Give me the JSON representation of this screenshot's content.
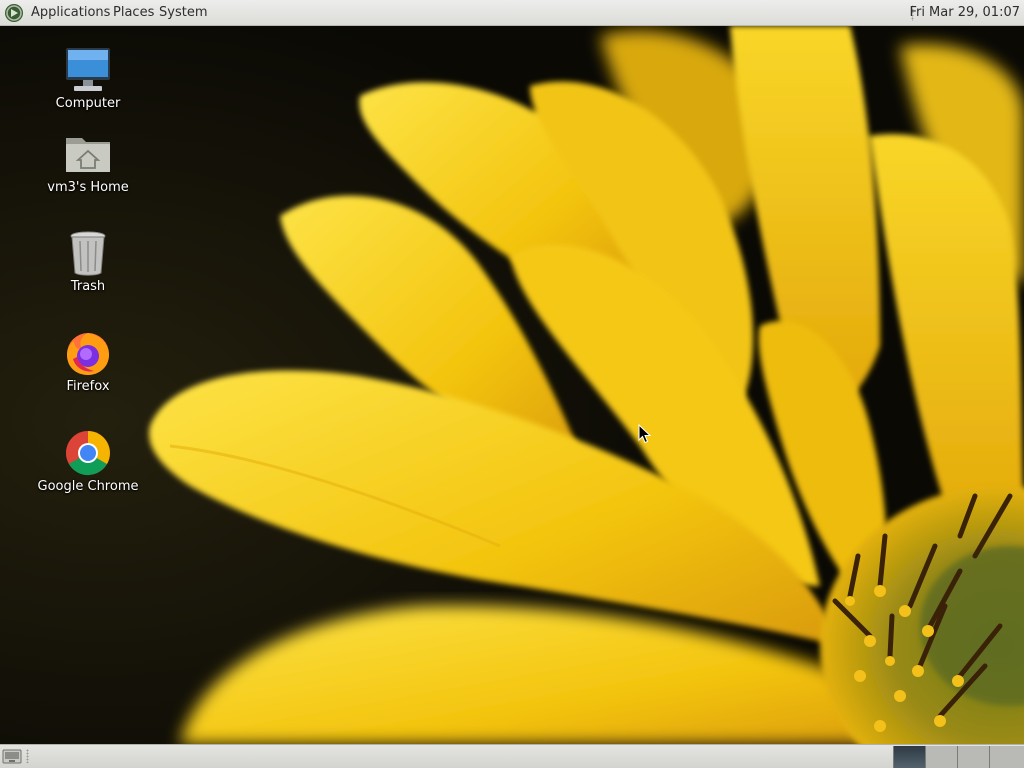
{
  "top_panel": {
    "menus": {
      "applications": "Applications",
      "places": "Places",
      "system": "System"
    },
    "clock": "Fri Mar 29, 01:07"
  },
  "desktop": {
    "wallpaper": "yellow flower close-up",
    "icons": [
      {
        "label": "Computer",
        "icon": "computer-icon"
      },
      {
        "label": "vm3's Home",
        "icon": "home-folder-icon"
      },
      {
        "label": "Trash",
        "icon": "trash-icon"
      },
      {
        "label": "Firefox",
        "icon": "firefox-icon"
      },
      {
        "label": "Google Chrome",
        "icon": "chrome-icon"
      }
    ]
  },
  "bottom_panel": {
    "workspaces": 4,
    "active_workspace": 1
  },
  "colors": {
    "panel": "#e4e4e1",
    "petal": "#f6cc12",
    "background": "#0b0a04"
  }
}
